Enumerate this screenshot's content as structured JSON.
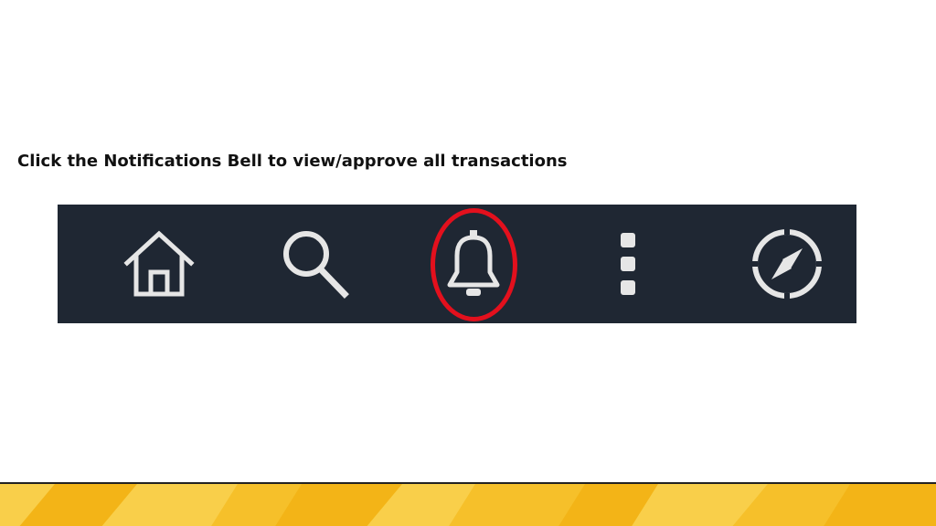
{
  "instruction": {
    "text": "Click the Notifications Bell to view/approve all transactions"
  },
  "navbar": {
    "background": "#1f2733",
    "icon_color": "#e6e6e6",
    "items": [
      {
        "icon": "home-icon"
      },
      {
        "icon": "search-icon"
      },
      {
        "icon": "bell-icon",
        "highlighted": true
      },
      {
        "icon": "more-vertical-icon"
      },
      {
        "icon": "compass-icon"
      }
    ]
  },
  "highlight": {
    "color": "#e3101d",
    "target": "bell-icon"
  },
  "footer": {
    "colors": [
      "#f7c12a",
      "#f9cf4a",
      "#f3b417"
    ]
  }
}
